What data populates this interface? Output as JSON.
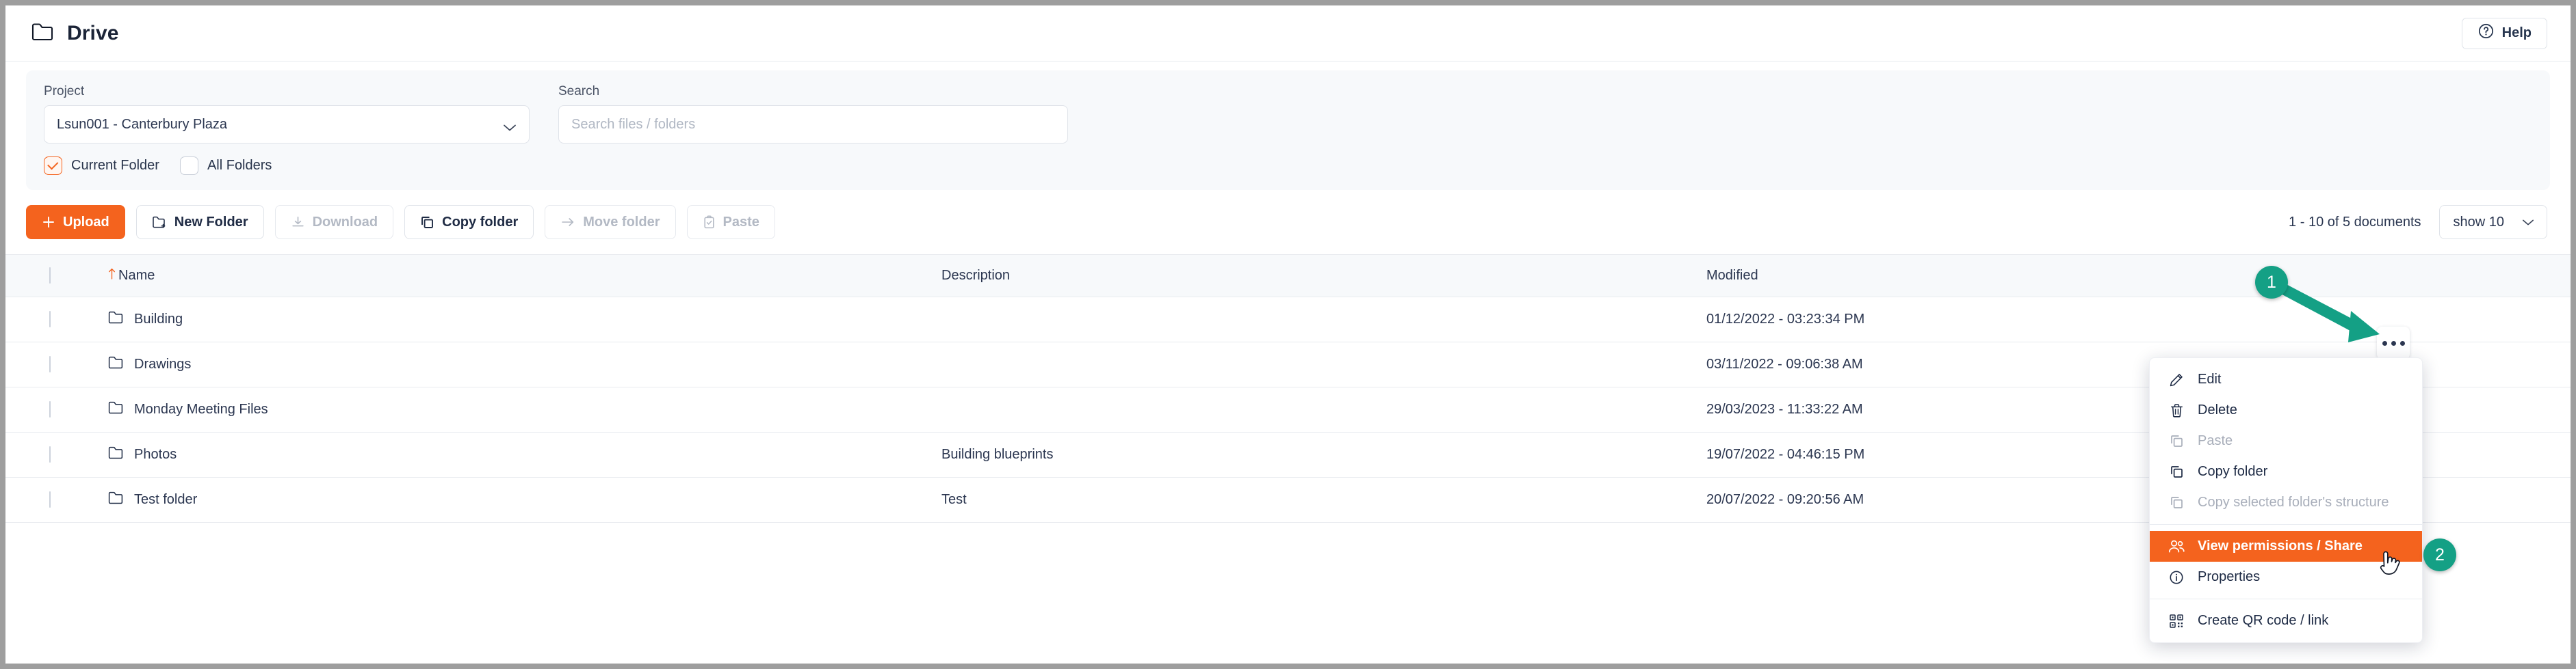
{
  "header": {
    "title": "Drive",
    "folder_icon": "folder-icon",
    "help_label": "Help",
    "help_icon": "question-circle-icon"
  },
  "filters": {
    "project": {
      "label": "Project",
      "value": "Lsun001 - Canterbury Plaza",
      "chevron_icon": "chevron-down-icon"
    },
    "search": {
      "label": "Search",
      "value": "",
      "placeholder": "Search files / folders"
    },
    "scope": [
      {
        "label": "Current Folder",
        "checked": true
      },
      {
        "label": "All Folders",
        "checked": false
      }
    ]
  },
  "toolbar": {
    "buttons": [
      {
        "label": "Upload",
        "icon": "plus-icon",
        "style": "primary",
        "disabled": false
      },
      {
        "label": "New Folder",
        "icon": "folder-plus-icon",
        "style": "default",
        "disabled": false
      },
      {
        "label": "Download",
        "icon": "download-icon",
        "style": "default",
        "disabled": true
      },
      {
        "label": "Copy folder",
        "icon": "copy-icon",
        "style": "default",
        "disabled": false
      },
      {
        "label": "Move folder",
        "icon": "arrow-right-icon",
        "style": "default",
        "disabled": true
      },
      {
        "label": "Paste",
        "icon": "clipboard-check-icon",
        "style": "default",
        "disabled": true
      }
    ],
    "pager_text": "1 - 10 of 5 documents",
    "show_value": "show 10",
    "show_chevron_icon": "chevron-down-icon"
  },
  "table": {
    "columns": {
      "select": "",
      "name": "Name",
      "description": "Description",
      "modified": "Modified",
      "actions": ""
    },
    "sort": {
      "column": "Name",
      "direction": "asc",
      "icon": "arrow-up-icon"
    },
    "rows": [
      {
        "name": "Building",
        "description": "",
        "modified": "01/12/2022 - 03:23:34 PM",
        "icon": "folder-icon",
        "selected": false
      },
      {
        "name": "Drawings",
        "description": "",
        "modified": "03/11/2022 - 09:06:38 AM",
        "icon": "folder-icon",
        "selected": false
      },
      {
        "name": "Monday Meeting Files",
        "description": "",
        "modified": "29/03/2023 - 11:33:22 AM",
        "icon": "folder-icon",
        "selected": false
      },
      {
        "name": "Photos",
        "description": "Building blueprints",
        "modified": "19/07/2022 - 04:46:15 PM",
        "icon": "folder-icon",
        "selected": false
      },
      {
        "name": "Test folder",
        "description": "Test",
        "modified": "20/07/2022 - 09:20:56 AM",
        "icon": "folder-icon",
        "selected": false
      }
    ]
  },
  "row_actions_button": {
    "icon": "kebab-menu-icon",
    "label": ""
  },
  "context_menu": {
    "items": [
      {
        "label": "Edit",
        "icon": "pencil-icon",
        "disabled": false,
        "active": false,
        "separator_after": false
      },
      {
        "label": "Delete",
        "icon": "trash-icon",
        "disabled": false,
        "active": false,
        "separator_after": false
      },
      {
        "label": "Paste",
        "icon": "copy-icon",
        "disabled": true,
        "active": false,
        "separator_after": false
      },
      {
        "label": "Copy folder",
        "icon": "copy-icon",
        "disabled": false,
        "active": false,
        "separator_after": false
      },
      {
        "label": "Copy selected folder's structure",
        "icon": "copy-icon",
        "disabled": true,
        "active": false,
        "separator_after": true
      },
      {
        "label": "View permissions / Share",
        "icon": "users-icon",
        "disabled": false,
        "active": true,
        "separator_after": false
      },
      {
        "label": "Properties",
        "icon": "info-circle-icon",
        "disabled": false,
        "active": false,
        "separator_after": true
      },
      {
        "label": "Create QR code / link",
        "icon": "qr-code-icon",
        "disabled": false,
        "active": false,
        "separator_after": false
      }
    ]
  },
  "annotations": {
    "markers": [
      {
        "id": "1",
        "label": "1"
      },
      {
        "id": "2",
        "label": "2"
      }
    ],
    "arrow_icon": "arrow-annotation",
    "cursor_icon": "hand-pointer-cursor",
    "accent_color": "#14a085"
  },
  "colors": {
    "brand_orange": "#f4631e",
    "text_dark": "#1d2a44",
    "panel_bg": "#f7f9fb",
    "border": "#e8ebef",
    "annotation_green": "#14a085"
  }
}
